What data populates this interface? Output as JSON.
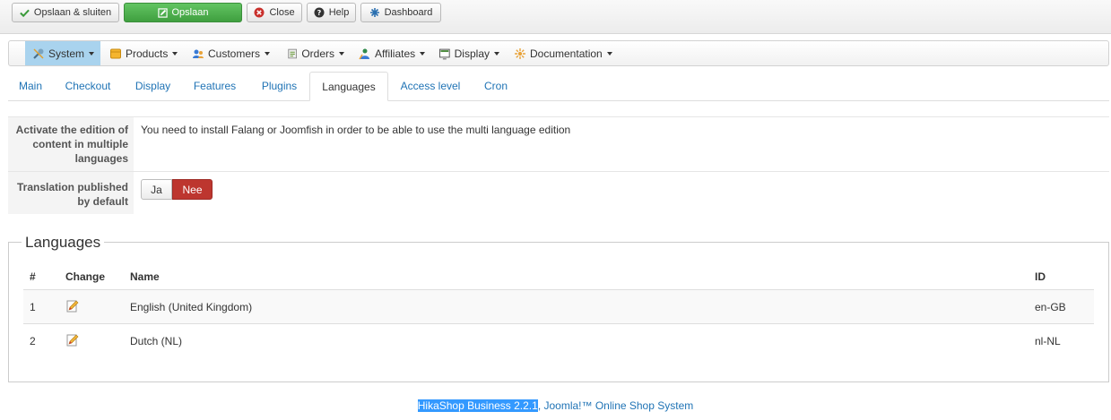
{
  "toolbar": {
    "save_close_label": "Opslaan & sluiten",
    "save_label": "Opslaan",
    "close_label": "Close",
    "help_label": "Help",
    "dashboard_label": "Dashboard"
  },
  "menu": {
    "items": [
      {
        "label": "System",
        "icon": "wrench-icon"
      },
      {
        "label": "Products",
        "icon": "box-icon"
      },
      {
        "label": "Customers",
        "icon": "users-icon"
      },
      {
        "label": "Orders",
        "icon": "orders-icon"
      },
      {
        "label": "Affiliates",
        "icon": "affiliates-icon"
      },
      {
        "label": "Display",
        "icon": "display-icon"
      },
      {
        "label": "Documentation",
        "icon": "documentation-icon"
      }
    ]
  },
  "tabs": [
    "Main",
    "Checkout",
    "Display",
    "Features",
    "Plugins",
    "Languages",
    "Access level",
    "Cron"
  ],
  "active_tab": "Languages",
  "settings": {
    "multilang_label": "Activate the edition of content in multiple languages",
    "multilang_value": "You need to install Falang or Joomfish in order to be able to use the multi language edition",
    "translation_label": "Translation published by default",
    "toggle_yes": "Ja",
    "toggle_no": "Nee",
    "toggle_selected": "Nee"
  },
  "languages": {
    "legend": "Languages",
    "headers": {
      "num": "#",
      "change": "Change",
      "name": "Name",
      "id": "ID"
    },
    "rows": [
      {
        "num": "1",
        "name": "English (United Kingdom)",
        "id": "en-GB"
      },
      {
        "num": "2",
        "name": "Dutch (NL)",
        "id": "nl-NL"
      }
    ]
  },
  "footer": {
    "product": "HikaShop Business 2.2.1",
    "rest": ", Joomla!™ Online Shop System"
  },
  "colors": {
    "accent": "#1f73b5",
    "save_green": "#51a351",
    "toggle_no_red": "#bd362f",
    "active_menu": "#a9d3ee"
  }
}
